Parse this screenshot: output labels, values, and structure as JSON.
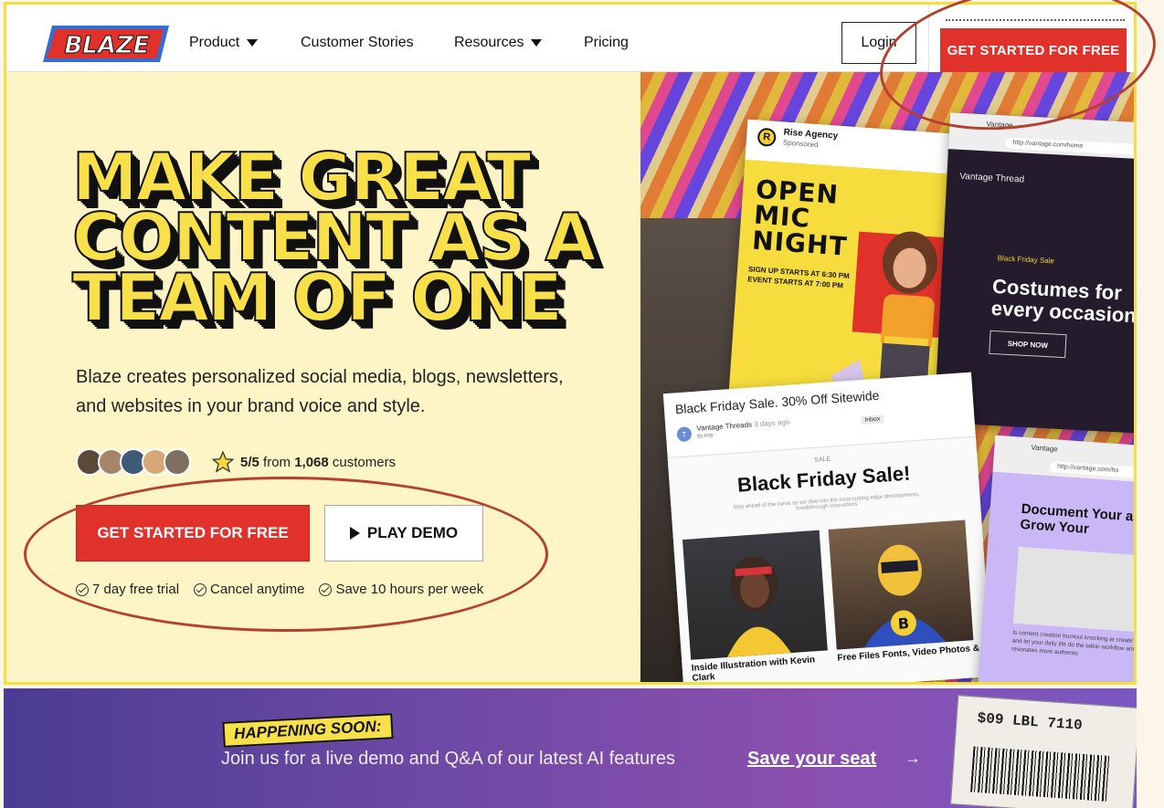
{
  "header": {
    "logo_text": "BLAZE",
    "nav": [
      {
        "label": "Product",
        "has_caret": true
      },
      {
        "label": "Customer Stories",
        "has_caret": false
      },
      {
        "label": "Resources",
        "has_caret": true
      },
      {
        "label": "Pricing",
        "has_caret": false
      }
    ],
    "login_label": "Login",
    "cta_label": "GET STARTED FOR FREE"
  },
  "hero": {
    "headline_lines": [
      "MAKE GREAT",
      "CONTENT AS A",
      "TEAM OF ONE"
    ],
    "subtitle_line1": "Blaze creates personalized social media, blogs, newsletters,",
    "subtitle_line2": "and websites in your brand voice and style.",
    "rating": {
      "score": "5/5",
      "from": "from",
      "count": "1,068",
      "suffix": "customers"
    },
    "cta_label": "GET STARTED FOR FREE",
    "demo_label": "PLAY DEMO",
    "perks": [
      "7 day free trial",
      "Cancel anytime",
      "Save 10 hours per week"
    ]
  },
  "collage": {
    "ig_card": {
      "logo_letter": "R",
      "account": "Rise Agency",
      "sponsored": "Sponsored",
      "headline": "OPEN MIC NIGHT",
      "line1": "SIGN UP STARTS AT 6:30 PM",
      "line2": "EVENT STARTS AT 7:00 PM"
    },
    "vantage_card": {
      "tab": "Vantage",
      "url": "http://vantage.com/home",
      "brand": "Vantage Thread",
      "tag": "Black Friday Sale",
      "headline": "Costumes for every occasion",
      "button": "SHOP NOW"
    },
    "email_card": {
      "subject": "Black Friday Sale. 30% Off Sitewide",
      "avatar_letter": "T",
      "sender": "Vantage Threads",
      "sender_meta": "3 days ago",
      "to": "to me",
      "badge": "Inbox",
      "eyebrow": "SALE",
      "title": "Black Friday Sale!",
      "desc": "Stay ahead of the curve as we dive into the most cutting-edge developments, breakthrough innovations",
      "caption1": "Inside Illustration with Kevin Clark",
      "caption2": "Free Files Fonts, Video Photos &"
    },
    "doc_card": {
      "tab": "Vantage",
      "url": "http://vantage.com/ho",
      "title": "Document Your and Grow Your",
      "text": "Is content creation burnout knocking at create' and let your daily life do the talkin workflow and resonates more authentic"
    }
  },
  "banner": {
    "badge": "HAPPENING SOON:",
    "text": "Join us for a live demo and Q&A of our latest AI features",
    "link": "Save your seat",
    "arrow": "→",
    "ticket_text": "$09 LBL 7110"
  },
  "colors": {
    "brand_red": "#e0312a",
    "headline_yellow": "#f7e04a",
    "hero_bg": "#fef5c6",
    "frame_border": "#f4df3c",
    "annotation": "#b4402e",
    "banner_purple": "#6f4aa6"
  },
  "icons": {
    "caret": "chevron-down-icon",
    "play": "play-icon",
    "check": "check-circle-icon",
    "star": "star-icon",
    "arrow": "arrow-right-icon"
  }
}
